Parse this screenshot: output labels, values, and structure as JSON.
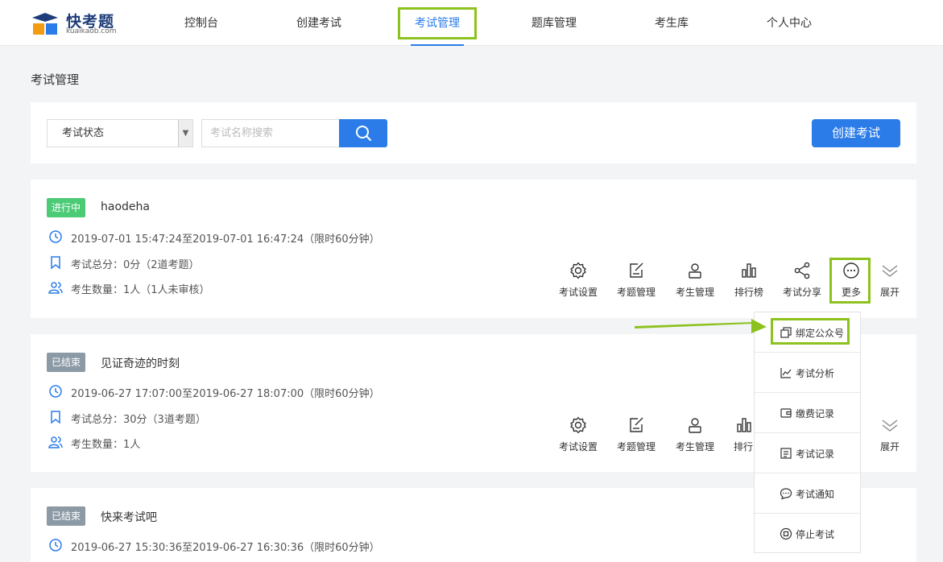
{
  "brand": {
    "name": "快考题",
    "sub": "kuaikaob.com",
    "colors": {
      "accent": "#2b7ce9",
      "highlight": "#8cc21d"
    }
  },
  "nav": {
    "items": [
      {
        "label": "控制台",
        "active": false
      },
      {
        "label": "创建考试",
        "active": false
      },
      {
        "label": "考试管理",
        "active": true
      },
      {
        "label": "题库管理",
        "active": false
      },
      {
        "label": "考生库",
        "active": false
      },
      {
        "label": "个人中心",
        "active": false
      }
    ]
  },
  "page": {
    "title": "考试管理"
  },
  "filter": {
    "status_value": "考试状态",
    "search_placeholder": "考试名称搜索",
    "search_icon": "search-icon",
    "create_label": "创建考试"
  },
  "exams": [
    {
      "status": "进行中",
      "name": "haodeha",
      "time": "2019-07-01 15:47:24至2019-07-01 16:47:24（限时60分钟）",
      "score": "考试总分：0分（2道考题）",
      "students": "考生数量：1人（1人未审核）"
    },
    {
      "status": "已结束",
      "name": "见证奇迹的时刻",
      "time": "2019-06-27 17:07:00至2019-06-27 18:07:00（限时60分钟）",
      "score": "考试总分：30分（3道考题）",
      "students": "考生数量：1人"
    },
    {
      "status": "已结束",
      "name": "快来考试吧",
      "time": "2019-06-27 15:30:36至2019-06-27 16:30:36（限时60分钟）"
    }
  ],
  "actions": {
    "settings": "考试设置",
    "questions": "考题管理",
    "students": "考生管理",
    "ranking": "排行榜",
    "ranking_cut": "排行",
    "share": "考试分享",
    "more": "更多",
    "expand": "展开"
  },
  "dropdown": {
    "items": [
      {
        "label": "绑定公众号",
        "icon": "copy-icon"
      },
      {
        "label": "考试分析",
        "icon": "line-chart-icon"
      },
      {
        "label": "缴费记录",
        "icon": "wallet-icon"
      },
      {
        "label": "考试记录",
        "icon": "document-icon"
      },
      {
        "label": "考试通知",
        "icon": "chat-icon"
      },
      {
        "label": "停止考试",
        "icon": "stop-icon"
      }
    ]
  }
}
